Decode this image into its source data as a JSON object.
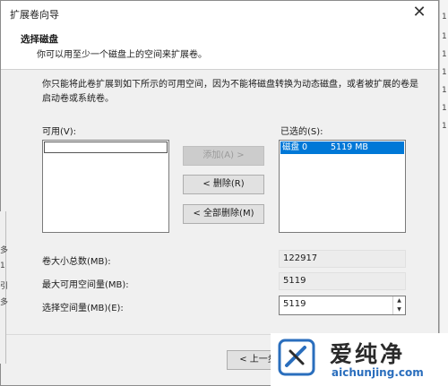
{
  "window": {
    "title": "扩展卷向导",
    "close_glyph": "✕"
  },
  "header": {
    "heading": "选择磁盘",
    "subheading": "你可以用至少一个磁盘上的空间来扩展卷。"
  },
  "description": "你只能将此卷扩展到如下所示的可用空间，因为不能将磁盘转换为动态磁盘，或者被扩展的卷是启动卷或系统卷。",
  "available": {
    "label": "可用(V):",
    "items": []
  },
  "selected": {
    "label": "已选的(S):",
    "items": [
      {
        "disk": "磁盘 0",
        "size": "5119 MB"
      }
    ]
  },
  "buttons": {
    "add": "添加(A) >",
    "remove": "< 删除(R)",
    "remove_all": "< 全部删除(M)",
    "back": "< 上一步"
  },
  "fields": {
    "total_label": "卷大小总数(MB):",
    "total_value": "122917",
    "max_label": "最大可用空间量(MB):",
    "max_value": "5119",
    "select_label": "选择空间量(MB)(E):",
    "select_value": "5119"
  },
  "watermark": {
    "brand": "爱纯净",
    "url": "aichunjing.com",
    "accent": "#2a6ebd"
  },
  "background": {
    "right_chars": [
      "1",
      "1",
      "1",
      "1",
      "1",
      "1",
      "1"
    ],
    "left_chars": [
      "多",
      "1",
      "引",
      "多"
    ]
  }
}
